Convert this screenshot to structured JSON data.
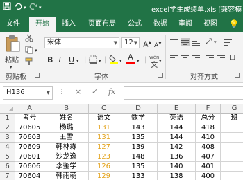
{
  "titlebar": {
    "title": "excel学生成绩单.xls [兼容模",
    "save_icon": "save-icon",
    "undo_icon": "undo-icon",
    "redo_icon": "redo-icon"
  },
  "ribbon_tabs": [
    "文件",
    "开始",
    "插入",
    "页面布局",
    "公式",
    "数据",
    "审阅",
    "视图"
  ],
  "active_tab": 1,
  "ribbon": {
    "clipboard": {
      "paste_label": "粘贴",
      "group_label": "剪贴板"
    },
    "font": {
      "font_name": "宋体",
      "font_size": "12",
      "bold": "B",
      "italic": "I",
      "underline": "U",
      "grow": "A",
      "shrink": "A",
      "wen": "wén",
      "font_color_letter": "A",
      "group_label": "字体",
      "fill_color": "#ffff00",
      "font_color": "#ff0000"
    },
    "alignment": {
      "group_label": "对齐方式"
    }
  },
  "formula_bar": {
    "name_box": "H136",
    "cancel": "×",
    "enter": "✓",
    "fx": "fx",
    "value": ""
  },
  "sheet": {
    "columns": [
      "A",
      "B",
      "C",
      "D",
      "E",
      "F",
      "G"
    ],
    "row_numbers": [
      "1",
      "2",
      "3",
      "4",
      "5",
      "6",
      "7"
    ],
    "rows": [
      [
        "考号",
        "姓名",
        "语文",
        "数学",
        "英语",
        "总分",
        "班"
      ],
      [
        "70605",
        "杨璐",
        "131",
        "143",
        "144",
        "418",
        ""
      ],
      [
        "70603",
        "王雪",
        "131",
        "135",
        "144",
        "410",
        ""
      ],
      [
        "70609",
        "韩林霖",
        "127",
        "139",
        "142",
        "408",
        ""
      ],
      [
        "70601",
        "沙龙逸",
        "123",
        "148",
        "136",
        "407",
        ""
      ],
      [
        "70606",
        "李鉴学",
        "126",
        "135",
        "140",
        "401",
        ""
      ],
      [
        "70604",
        "韩雨萌",
        "129",
        "133",
        "138",
        "400",
        ""
      ]
    ],
    "highlight_text_color": "#e3a21a"
  }
}
